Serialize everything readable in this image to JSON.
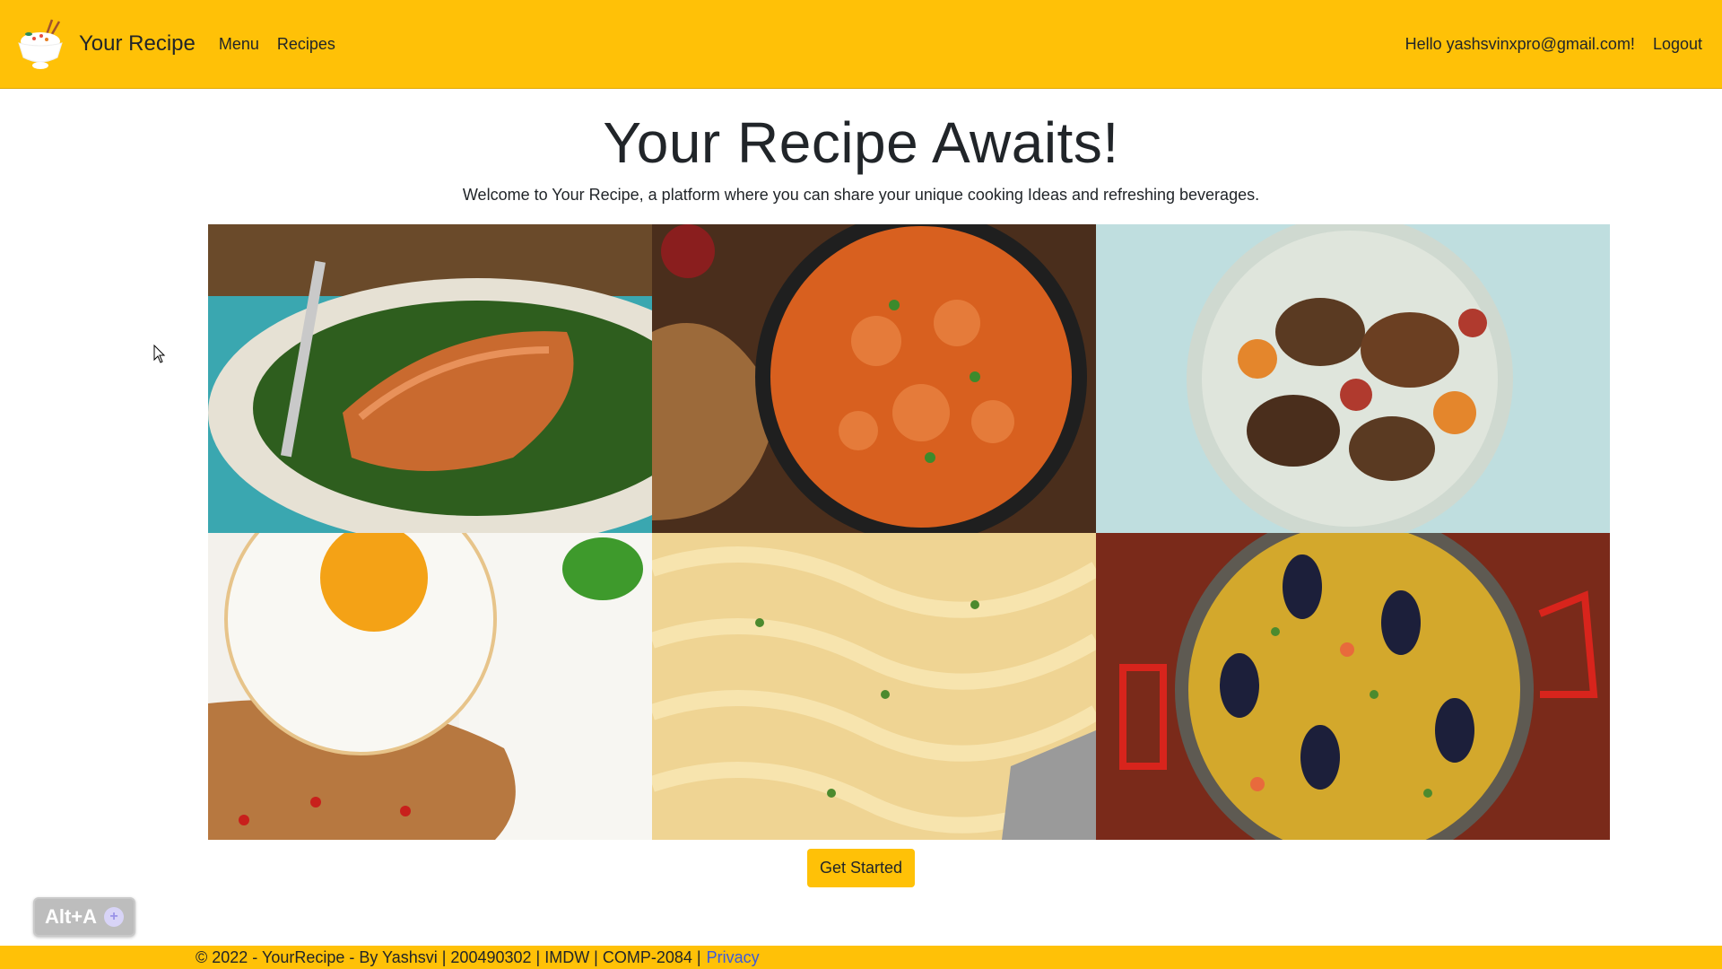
{
  "colors": {
    "brand": "#ffc107",
    "link": "#3b5bdb"
  },
  "navbar": {
    "brand": "Your Recipe",
    "links": [
      "Menu",
      "Recipes"
    ],
    "greeting": "Hello yashsvinxpro@gmail.com!",
    "logout": "Logout"
  },
  "hero": {
    "title": "Your Recipe Awaits!",
    "subtitle": "Welcome to Your Recipe, a platform where you can share your unique cooking Ideas and refreshing beverages."
  },
  "gallery": [
    "salmon-image",
    "butter-chicken-image",
    "roast-chicken-image",
    "fried-egg-rice-image",
    "fettuccine-image",
    "paella-image"
  ],
  "cta": {
    "label": "Get Started"
  },
  "badge": {
    "label": "Alt+A"
  },
  "footer": {
    "text": "© 2022 - YourRecipe - By Yashsvi | 200490302 | IMDW | COMP-2084 |",
    "privacy": "Privacy"
  }
}
